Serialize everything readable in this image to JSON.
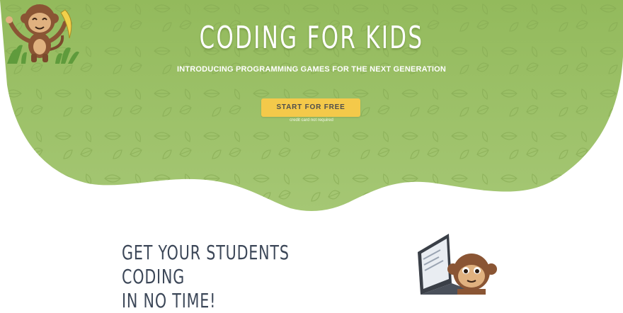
{
  "hero": {
    "title": "CODING FOR KIDS",
    "subtitle": "INTRODUCING PROGRAMMING GAMES FOR THE NEXT GENERATION",
    "cta_label": "START FOR FREE",
    "cta_note": "credit card not required"
  },
  "intro": {
    "heading_line1": "GET YOUR STUDENTS CODING",
    "heading_line2": "IN NO TIME!"
  },
  "colors": {
    "hero_green": "#97bd62",
    "cta_yellow": "#f4c94a",
    "heading_text": "#3c4758"
  },
  "icons": {
    "mascot": "monkey-holding-banana",
    "laptop_mascot": "monkey-at-laptop",
    "background": "leaf-pattern"
  }
}
